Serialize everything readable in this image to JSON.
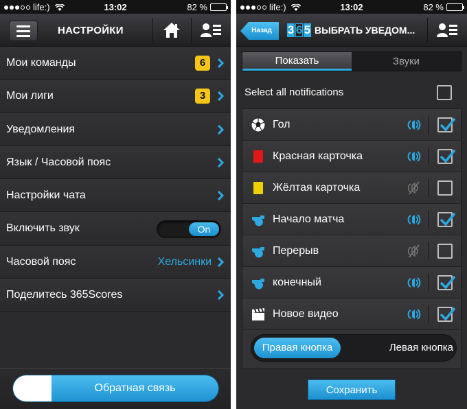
{
  "left_screen": {
    "status": {
      "carrier": "life:)",
      "time": "13:02",
      "battery": "82 %",
      "battery_level": 0.82
    },
    "header": {
      "title": "НАСТРОЙКИ"
    },
    "menu": [
      {
        "label": "Мои команды",
        "badge": "6"
      },
      {
        "label": "Мои лиги",
        "badge": "3"
      },
      {
        "label": "Уведомления"
      },
      {
        "label": "Язык / Часовой пояс"
      },
      {
        "label": "Настройки чата"
      },
      {
        "label": "Включить звук",
        "toggle": "On"
      },
      {
        "label": "Часовой пояс",
        "value": "Хельсинки"
      },
      {
        "label": "Поделитесь 365Scores"
      }
    ],
    "feedback_label": "Обратная связь"
  },
  "right_screen": {
    "status": {
      "carrier": "life:)",
      "time": "13:02",
      "battery": "82 %",
      "battery_level": 0.82
    },
    "header": {
      "back": "Назад",
      "logo": [
        "3",
        "6",
        "5"
      ],
      "title": "ВЫБРАТЬ УВЕДОМ..."
    },
    "tabs": [
      "Показать",
      "Звуки"
    ],
    "select_all": "Select all notifications",
    "notifications": [
      {
        "label": "Гол",
        "icon": "soccer-ball-icon",
        "sound": true,
        "checked": true
      },
      {
        "label": "Красная карточка",
        "icon": "red-card-icon",
        "sound": true,
        "checked": true
      },
      {
        "label": "Жёлтая карточка",
        "icon": "yellow-card-icon",
        "sound": false,
        "checked": false
      },
      {
        "label": "Начало матча",
        "icon": "whistle-icon",
        "sound": true,
        "checked": true
      },
      {
        "label": "Перерыв",
        "icon": "whistle-icon",
        "sound": false,
        "checked": false
      },
      {
        "label": "конечный",
        "icon": "whistle-icon",
        "sound": true,
        "checked": true
      },
      {
        "label": "Новое видео",
        "icon": "clapperboard-icon",
        "sound": true,
        "checked": true
      }
    ],
    "button_toggle": {
      "right": "Правая кнопка",
      "left": "Левая кнопка"
    },
    "save_label": "Сохранить"
  },
  "colors": {
    "accent": "#2da8e0",
    "badge": "#f5c518",
    "background": "#2b2b2d"
  }
}
